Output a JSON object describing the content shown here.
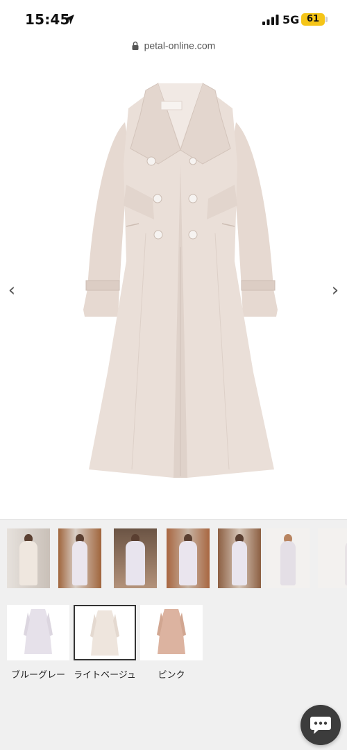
{
  "status_bar": {
    "time": "15:45",
    "network": "5G",
    "battery": "61",
    "icons": [
      "location-arrow-icon",
      "signal-bars-icon",
      "battery-icon"
    ]
  },
  "browser": {
    "url": "petal-online.com",
    "lock_icon": "lock-icon"
  },
  "gallery": {
    "prev_arrow": "‹",
    "next_arrow": "›",
    "image_subject": "light beige long trench coat",
    "colors": {
      "coat": "#e9ddd6",
      "coat_shadow": "#d9cbc3",
      "button": "#f4f1ef"
    }
  },
  "thumbnails": {
    "count": 7,
    "colors": [
      "#d9d4cf",
      "#a86a3d",
      "#8a6b52",
      "#b07248",
      "#9a6a4a",
      "#f2f0ee",
      "#f3f1ef"
    ]
  },
  "color_options": [
    {
      "label": "ブルーグレー",
      "color": "#e6e1ea",
      "selected": false
    },
    {
      "label": "ライトベージュ",
      "color": "#eee5dd",
      "selected": true
    },
    {
      "label": "ピンク",
      "color": "#dcb3a0",
      "selected": false
    }
  ],
  "chat": {
    "icon": "chat-bubble-icon",
    "color": "#3c3c3c"
  }
}
